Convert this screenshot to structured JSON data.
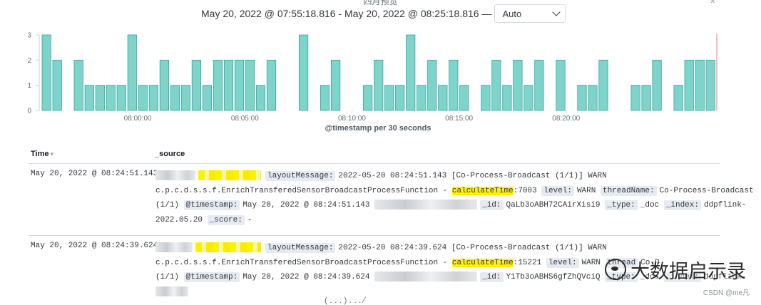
{
  "header": {
    "partial_title": "四月预览",
    "time_range": "May 20, 2022 @ 07:55:18.816 - May 20, 2022 @ 08:25:18.816 —",
    "interval_value": "Auto",
    "close_glyph": "×"
  },
  "chart_data": {
    "type": "bar",
    "xlabel": "@timestamp per 30 seconds",
    "ylabel": "",
    "ylim": [
      0,
      3
    ],
    "y_ticks": [
      0,
      1,
      2,
      3
    ],
    "x_ticks": [
      "08:00:00",
      "08:05:00",
      "08:10:00",
      "08:15:00",
      "08:20:00"
    ],
    "bar_interval_seconds": 30,
    "first_bar_time": "07:55:30",
    "values": [
      3,
      2,
      0,
      2,
      1,
      1,
      1,
      1,
      3,
      1,
      1,
      2,
      1,
      1,
      2,
      1,
      2,
      2,
      2,
      2,
      1,
      2,
      0,
      0,
      3,
      0,
      1,
      2,
      0,
      0,
      1,
      2,
      1,
      1,
      3,
      1,
      2,
      1,
      2,
      1,
      0,
      1,
      2,
      1,
      2,
      1,
      2,
      0,
      2,
      0,
      1,
      1,
      2,
      0,
      0,
      1,
      1,
      2,
      0,
      1,
      2,
      2,
      2
    ],
    "bar_color": "#7ed3cb",
    "bar_stroke": "#34a79e",
    "now_line_color": "#f0a6a6",
    "grid": false
  },
  "table": {
    "col_time": "Time",
    "col_source": "_source",
    "sort_glyph": "▾",
    "rows": [
      {
        "time": "May 20, 2022 @ 08:24:51.143",
        "layoutMessage_key": "layoutMessage:",
        "layoutMessage_val": "2022-05-20 08:24:51.143 [Co-Process-Broadcast (1/1)] WARN",
        "line2_prefix": "c.p.c.d.s.s.f.EnrichTransferedSensorBroadcastProcessFunction -",
        "calc_key": "calculateTime",
        "calc_val": ":7003",
        "level_key": "level:",
        "level_val": "WARN",
        "thread_key": "threadName:",
        "thread_val": "Co-Process-Broadcast",
        "line3_prefix": "(1/1)",
        "ts_key": "@timestamp:",
        "ts_val": "May 20, 2022 @ 08:24:51.143",
        "id_key": "_id:",
        "id_val": "QaLb3oABH72CAirXisi9",
        "type_key": "_type:",
        "type_val": "_doc",
        "index_key": "_index:",
        "index_val": "ddpflink-",
        "line4_index_cont": "2022.05.20",
        "score_key": "_score:",
        "score_val": "-"
      },
      {
        "time": "May 20, 2022 @ 08:24:39.624",
        "layoutMessage_key": "layoutMessage:",
        "layoutMessage_val": "2022-05-20 08:24:39.624 [Co-Process-Broadcast (1/1)] WARN",
        "line2_prefix": "c.p.c.d.s.s.f.EnrichTransferedSensorBroadcastProcessFunction -",
        "calc_key": "calculateTime",
        "calc_val": ":15221",
        "level_key": "level:",
        "level_val": "WARN",
        "thread_key": "thread",
        "thread_val": "Co-P",
        "line3_prefix": "(1/1)",
        "ts_key": "@timestamp:",
        "ts_val": "May 20, 2022 @ 08:24:39.624",
        "id_key": "_id:",
        "id_val": "Y1Tb3oABHS6gfZhQVciQ",
        "type_key": "_type:",
        "type_val": "_doc",
        "index_key": "_index:",
        "index_val": "ddpflink-"
      }
    ]
  },
  "overlay": {
    "watermark_text": "大数据启示录",
    "csdn_text": "CSDN @me凡",
    "bottom_partial": "( . . . )  .  .  .  ⁄"
  }
}
